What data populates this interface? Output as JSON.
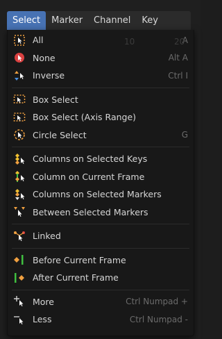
{
  "menubar": {
    "items": [
      {
        "label": "Select",
        "active": true
      },
      {
        "label": "Marker"
      },
      {
        "label": "Channel"
      },
      {
        "label": "Key"
      }
    ]
  },
  "background_ghost": {
    "left_num": "10",
    "right_num": "20"
  },
  "menu": {
    "groups": [
      [
        {
          "icon": "select-all-icon",
          "label": "All",
          "shortcut": "A"
        },
        {
          "icon": "select-none-icon",
          "label": "None",
          "shortcut": "Alt A"
        },
        {
          "icon": "select-inverse-icon",
          "label": "Inverse",
          "shortcut": "Ctrl I"
        }
      ],
      [
        {
          "icon": "box-select-icon",
          "label": "Box Select",
          "shortcut": ""
        },
        {
          "icon": "box-select-axis-icon",
          "label": "Box Select (Axis Range)",
          "shortcut": ""
        },
        {
          "icon": "circle-select-icon",
          "label": "Circle Select",
          "shortcut": "G"
        }
      ],
      [
        {
          "icon": "columns-selected-keys-icon",
          "label": "Columns on Selected Keys",
          "shortcut": ""
        },
        {
          "icon": "column-current-frame-icon",
          "label": "Column on Current Frame",
          "shortcut": ""
        },
        {
          "icon": "columns-selected-markers-icon",
          "label": "Columns on Selected Markers",
          "shortcut": ""
        },
        {
          "icon": "between-selected-markers-icon",
          "label": "Between Selected Markers",
          "shortcut": ""
        }
      ],
      [
        {
          "icon": "linked-icon",
          "label": "Linked",
          "shortcut": ""
        }
      ],
      [
        {
          "icon": "before-current-frame-icon",
          "label": "Before Current Frame",
          "shortcut": ""
        },
        {
          "icon": "after-current-frame-icon",
          "label": "After Current Frame",
          "shortcut": ""
        }
      ],
      [
        {
          "icon": "select-more-icon",
          "label": "More",
          "shortcut": "Ctrl Numpad +"
        },
        {
          "icon": "select-less-icon",
          "label": "Less",
          "shortcut": "Ctrl Numpad -"
        }
      ]
    ]
  }
}
